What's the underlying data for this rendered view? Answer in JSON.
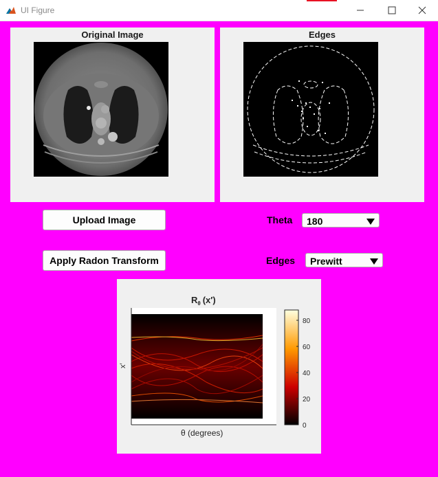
{
  "window": {
    "title": "UI Figure"
  },
  "panels": {
    "original": {
      "title": "Original Image"
    },
    "edges": {
      "title": "Edges"
    }
  },
  "buttons": {
    "upload": "Upload Image",
    "radon": "Apply Radon Transform"
  },
  "controls": {
    "theta": {
      "label": "Theta",
      "value": "180"
    },
    "edges": {
      "label": "Edges",
      "value": "Prewitt"
    }
  },
  "plot": {
    "title_main": "R",
    "title_sub": "θ",
    "title_arg": "(x′)",
    "xlabel": "θ (degrees)",
    "ylabel": "x′",
    "colorbar": {
      "ticks": [
        "80",
        "60",
        "40",
        "20",
        "0"
      ]
    }
  },
  "colors": {
    "background": "#ff00ff",
    "panel": "#f0f0f0",
    "accent": "#e81123"
  }
}
